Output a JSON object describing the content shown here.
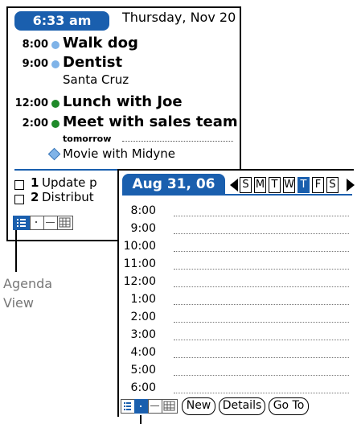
{
  "agenda": {
    "time": "6:33 am",
    "date": "Thursday, Nov 20",
    "appointments": [
      {
        "time": "8:00",
        "title": "Walk dog",
        "dot": "#7fb3e8"
      },
      {
        "time": "9:00",
        "title": "Dentist",
        "subtitle": "Santa Cruz",
        "dot": "#7fb3e8"
      },
      {
        "time": "12:00",
        "title": "Lunch with Joe",
        "dot": "#1f8a2a"
      },
      {
        "time": "2:00",
        "title": "Meet with sales team",
        "dot": "#1f8a2a"
      }
    ],
    "tomorrow_label": "tomorrow",
    "untimed_event": "Movie with Midyne",
    "tasks": [
      {
        "num": "1",
        "text": "Update p"
      },
      {
        "num": "2",
        "text": "Distribut"
      }
    ]
  },
  "dayview": {
    "date": "Aug 31, 06",
    "weekdays": [
      "S",
      "M",
      "T",
      "W",
      "T",
      "F",
      "S"
    ],
    "selected_weekday_index": 4,
    "times": [
      "8:00",
      "9:00",
      "10:00",
      "11:00",
      "12:00",
      "1:00",
      "2:00",
      "3:00",
      "4:00",
      "5:00",
      "6:00"
    ],
    "buttons": {
      "new": "New",
      "details": "Details",
      "goto": "Go To"
    }
  },
  "callout": {
    "label_line1": "Agenda",
    "label_line2": "View"
  },
  "colors": {
    "accent": "#1a5fae",
    "dot_blue": "#7fb3e8",
    "dot_green": "#1f8a2a"
  }
}
